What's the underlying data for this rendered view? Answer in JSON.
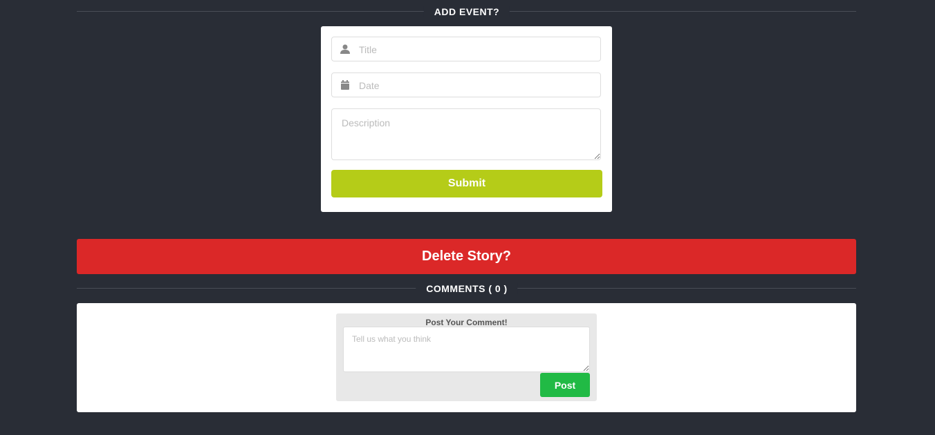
{
  "add_event": {
    "heading": "ADD EVENT?",
    "title_placeholder": "Title",
    "date_placeholder": "Date",
    "description_placeholder": "Description",
    "submit_label": "Submit"
  },
  "delete_label": "Delete Story?",
  "comments": {
    "heading": "COMMENTS ( 0 )",
    "box_title": "Post Your Comment!",
    "placeholder": "Tell us what you think",
    "post_label": "Post"
  },
  "colors": {
    "submit": "#b5cc18",
    "delete": "#db2828",
    "post": "#21ba45"
  }
}
